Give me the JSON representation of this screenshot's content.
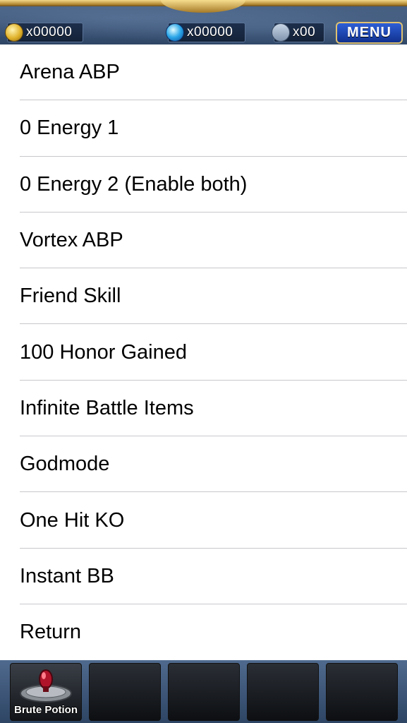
{
  "hud": {
    "gold_value": "x00000",
    "gem_value": "x00000",
    "item_value": "x00",
    "menu_label": "MENU"
  },
  "list": {
    "items": [
      {
        "label": "Arena ABP"
      },
      {
        "label": "0 Energy 1"
      },
      {
        "label": "0 Energy 2 (Enable both)"
      },
      {
        "label": "Vortex ABP"
      },
      {
        "label": "Friend Skill"
      },
      {
        "label": "100 Honor Gained"
      },
      {
        "label": "Infinite Battle Items"
      },
      {
        "label": "Godmode"
      },
      {
        "label": "One Hit KO"
      },
      {
        "label": "Instant BB"
      },
      {
        "label": "Return"
      }
    ]
  },
  "bottom_bar": {
    "slots": [
      {
        "label": "Brute Potion",
        "icon": "potion-icon"
      },
      {
        "label": ""
      },
      {
        "label": ""
      },
      {
        "label": ""
      },
      {
        "label": ""
      }
    ]
  },
  "colors": {
    "hud_bg": "#3b5578",
    "gold_trim": "#c9a24a",
    "menu_button": "#1f48b8",
    "separator": "#c8c7cc",
    "text": "#000000"
  }
}
